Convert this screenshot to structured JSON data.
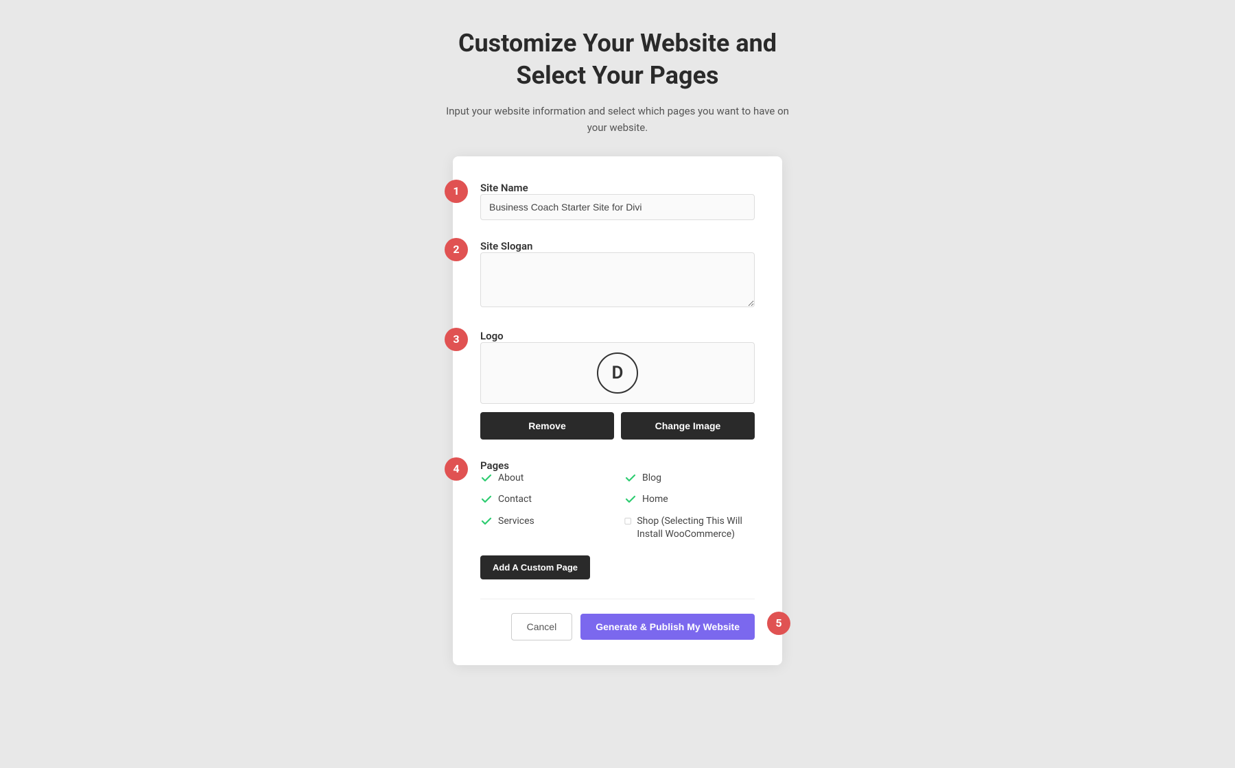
{
  "header": {
    "title_line1": "Customize Your Website and",
    "title_line2": "Select Your Pages",
    "subtitle": "Input your website information and select which pages you want to have on your website."
  },
  "form": {
    "sections": {
      "site_name": {
        "step": "1",
        "label": "Site Name",
        "value": "Business Coach Starter Site for Divi",
        "placeholder": "Business Coach Starter Site for Divi"
      },
      "site_slogan": {
        "step": "2",
        "label": "Site Slogan",
        "value": "",
        "placeholder": ""
      },
      "logo": {
        "step": "3",
        "label": "Logo",
        "letter": "D",
        "remove_btn": "Remove",
        "change_btn": "Change Image"
      },
      "pages": {
        "step": "4",
        "label": "Pages",
        "items": [
          {
            "name": "About",
            "checked": true
          },
          {
            "name": "Blog",
            "checked": true
          },
          {
            "name": "Contact",
            "checked": true
          },
          {
            "name": "Home",
            "checked": true
          },
          {
            "name": "Services",
            "checked": true
          },
          {
            "name": "Shop (Selecting This Will Install WooCommerce)",
            "checked": false
          }
        ],
        "add_custom_label": "Add A Custom Page"
      }
    },
    "footer": {
      "cancel_label": "Cancel",
      "publish_label": "Generate & Publish My Website",
      "step5": "5"
    }
  }
}
